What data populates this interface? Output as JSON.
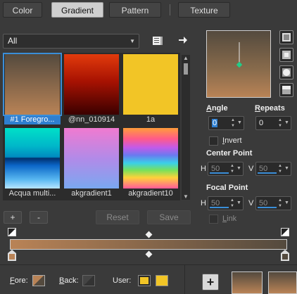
{
  "tabs": [
    "Color",
    "Gradient",
    "Pattern",
    "Texture"
  ],
  "active_tab": "Gradient",
  "filter": {
    "value": "All"
  },
  "gradients": [
    {
      "label": "#1 Foregro...",
      "selected": true
    },
    {
      "label": "@nn_010914",
      "selected": false
    },
    {
      "label": "1a",
      "selected": false
    },
    {
      "label": "Acqua multi...",
      "selected": false
    },
    {
      "label": "akgradient1",
      "selected": false
    },
    {
      "label": "akgradient10",
      "selected": false
    }
  ],
  "list_buttons": {
    "add": "+",
    "remove": "-",
    "reset": "Reset",
    "save": "Save"
  },
  "angle": {
    "label_prefix": "A",
    "label_rest": "ngle",
    "value": "0"
  },
  "repeats": {
    "label_prefix": "R",
    "label_rest": "epeats",
    "value": "0"
  },
  "invert": {
    "label_prefix": "I",
    "label_rest": "nvert",
    "checked": false
  },
  "center_point": {
    "label": "Center Point",
    "h_label": "H",
    "h": "50",
    "v_label": "V",
    "v": "50"
  },
  "focal_point": {
    "label": "Focal Point",
    "h_label": "H",
    "h": "50",
    "v_label": "V",
    "v": "50"
  },
  "link": {
    "label_prefix": "L",
    "label_rest": "ink",
    "checked": false
  },
  "bottom": {
    "fore_prefix": "F",
    "fore_rest": "ore:",
    "back_prefix": "B",
    "back_rest": "ack:",
    "user_label": "User:",
    "add_button": "+"
  },
  "colors": {
    "accent": "#2f7fd0",
    "grad_start": "#b98356",
    "grad_end": "#544a3e",
    "user_yellow": "#f2c526"
  }
}
